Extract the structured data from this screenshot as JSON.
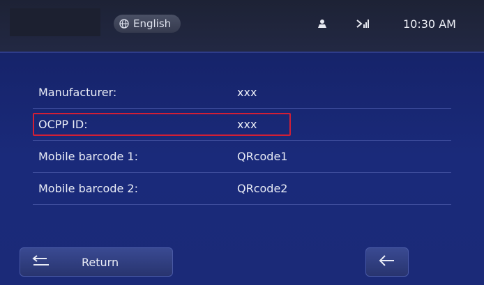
{
  "topbar": {
    "language": "English",
    "time": "10:30 AM",
    "icons": {
      "language": "globe-icon",
      "user": "user-icon",
      "signal": "signal-off-icon"
    }
  },
  "info": {
    "rows": [
      {
        "label": "Manufacturer:",
        "value": "xxx",
        "highlighted": false
      },
      {
        "label": "OCPP ID:",
        "value": "xxx",
        "highlighted": true
      },
      {
        "label": "Mobile barcode 1:",
        "value": "QRcode1",
        "highlighted": false
      },
      {
        "label": "Mobile barcode 2:",
        "value": "QRcode2",
        "highlighted": false
      }
    ]
  },
  "buttons": {
    "return_label": "Return",
    "return_icon": "return-arrow-icon",
    "back_icon": "back-arrow-icon"
  },
  "colors": {
    "background": "#1b2a78",
    "topbar": "#1d2235",
    "highlight": "#d21f35",
    "text": "#e9ecf6"
  }
}
